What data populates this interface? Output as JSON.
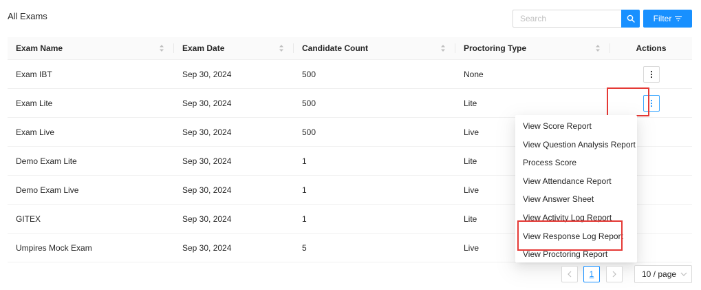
{
  "header": {
    "title": "All Exams",
    "search_placeholder": "Search",
    "filter_label": "Filter"
  },
  "table": {
    "columns": [
      "Exam Name",
      "Exam Date",
      "Candidate Count",
      "Proctoring Type",
      "Actions"
    ],
    "rows": [
      {
        "name": "Exam IBT",
        "date": "Sep 30, 2024",
        "count": "500",
        "proctoring": "None"
      },
      {
        "name": "Exam Lite",
        "date": "Sep 30, 2024",
        "count": "500",
        "proctoring": "Lite"
      },
      {
        "name": "Exam Live",
        "date": "Sep 30, 2024",
        "count": "500",
        "proctoring": "Live"
      },
      {
        "name": "Demo Exam Lite",
        "date": "Sep 30, 2024",
        "count": "1",
        "proctoring": "Lite"
      },
      {
        "name": "Demo Exam Live",
        "date": "Sep 30, 2024",
        "count": "1",
        "proctoring": "Live"
      },
      {
        "name": "GITEX",
        "date": "Sep 30, 2024",
        "count": "1",
        "proctoring": "Lite"
      },
      {
        "name": "Umpires Mock Exam",
        "date": "Sep 30, 2024",
        "count": "5",
        "proctoring": "Live"
      }
    ]
  },
  "action_menu": {
    "items": [
      "View Score Report",
      "View Question Analysis Report",
      "Process Score",
      "View Attendance Report",
      "View Answer Sheet",
      "View Activity Log Report",
      "View Response Log Report",
      "View Proctoring Report"
    ]
  },
  "pagination": {
    "current_page": "1",
    "page_size": "10 / page"
  },
  "colors": {
    "primary": "#1890ff",
    "highlight": "#e53935"
  }
}
